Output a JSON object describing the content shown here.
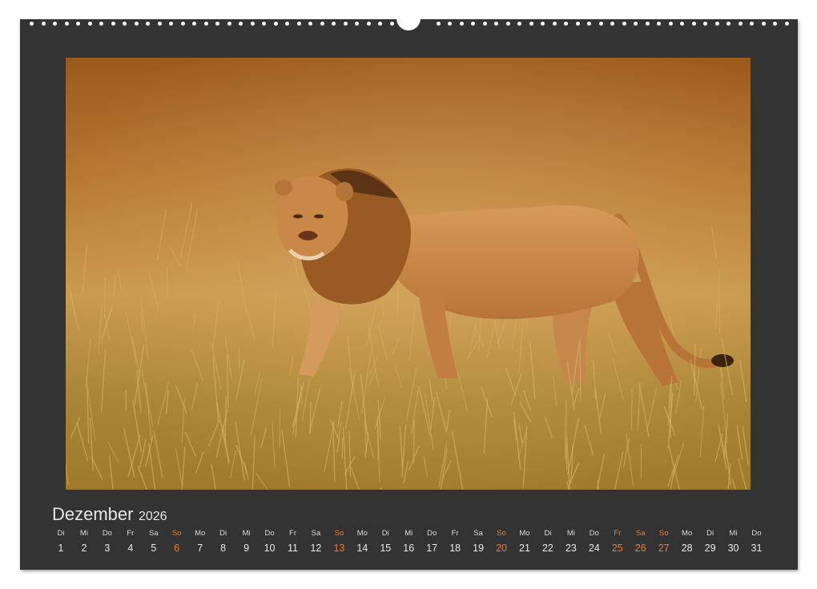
{
  "month": {
    "name": "Dezember",
    "year": "2026"
  },
  "colors": {
    "frame": "#333333",
    "text": "#e8e8e8",
    "holiday": "#f07a2a"
  },
  "photo": {
    "subject": "lion-walking-in-grass"
  },
  "days": [
    {
      "wd": "Di",
      "d": "1"
    },
    {
      "wd": "Mi",
      "d": "2"
    },
    {
      "wd": "Do",
      "d": "3"
    },
    {
      "wd": "Fr",
      "d": "4"
    },
    {
      "wd": "Sa",
      "d": "5"
    },
    {
      "wd": "So",
      "d": "6",
      "holiday": true
    },
    {
      "wd": "Mo",
      "d": "7"
    },
    {
      "wd": "Di",
      "d": "8"
    },
    {
      "wd": "Mi",
      "d": "9"
    },
    {
      "wd": "Do",
      "d": "10"
    },
    {
      "wd": "Fr",
      "d": "11"
    },
    {
      "wd": "Sa",
      "d": "12"
    },
    {
      "wd": "So",
      "d": "13",
      "holiday": true
    },
    {
      "wd": "Mo",
      "d": "14"
    },
    {
      "wd": "Di",
      "d": "15"
    },
    {
      "wd": "Mi",
      "d": "16"
    },
    {
      "wd": "Do",
      "d": "17"
    },
    {
      "wd": "Fr",
      "d": "18"
    },
    {
      "wd": "Sa",
      "d": "19"
    },
    {
      "wd": "So",
      "d": "20",
      "holiday": true
    },
    {
      "wd": "Mo",
      "d": "21"
    },
    {
      "wd": "Di",
      "d": "22"
    },
    {
      "wd": "Mi",
      "d": "23"
    },
    {
      "wd": "Do",
      "d": "24"
    },
    {
      "wd": "Fr",
      "d": "25",
      "holiday": true
    },
    {
      "wd": "Sa",
      "d": "26",
      "holiday": true
    },
    {
      "wd": "So",
      "d": "27",
      "holiday": true
    },
    {
      "wd": "Mo",
      "d": "28"
    },
    {
      "wd": "Di",
      "d": "29"
    },
    {
      "wd": "Mi",
      "d": "30"
    },
    {
      "wd": "Do",
      "d": "31"
    }
  ]
}
